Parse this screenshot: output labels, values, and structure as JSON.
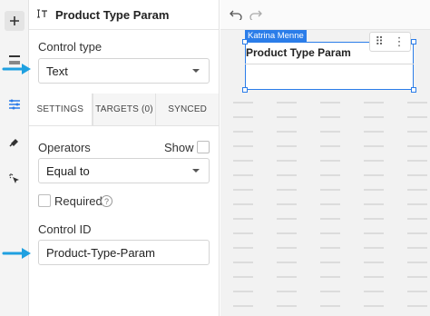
{
  "panel": {
    "title": "Product Type Param",
    "control_type_label": "Control type",
    "control_type_value": "Text",
    "tabs": [
      {
        "label": "SETTINGS",
        "active": true
      },
      {
        "label": "TARGETS (0)",
        "active": false
      },
      {
        "label": "SYNCED",
        "active": false
      }
    ],
    "operators_label": "Operators",
    "show_label": "Show",
    "operator_value": "Equal to",
    "required_label": "Required",
    "control_id_label": "Control ID",
    "control_id_value": "Product-Type-Param"
  },
  "canvas": {
    "owner_badge": "Katrina Menne",
    "control_title": "Product Type Param"
  },
  "colors": {
    "accent": "#2b7de9",
    "callout_arrow": "#1fa0e0"
  },
  "icons": {
    "rail": [
      "plus-icon",
      "element-icon",
      "properties-icon",
      "format-paint-icon",
      "interaction-icon"
    ],
    "toolbar": [
      "undo-icon",
      "redo-icon"
    ]
  }
}
